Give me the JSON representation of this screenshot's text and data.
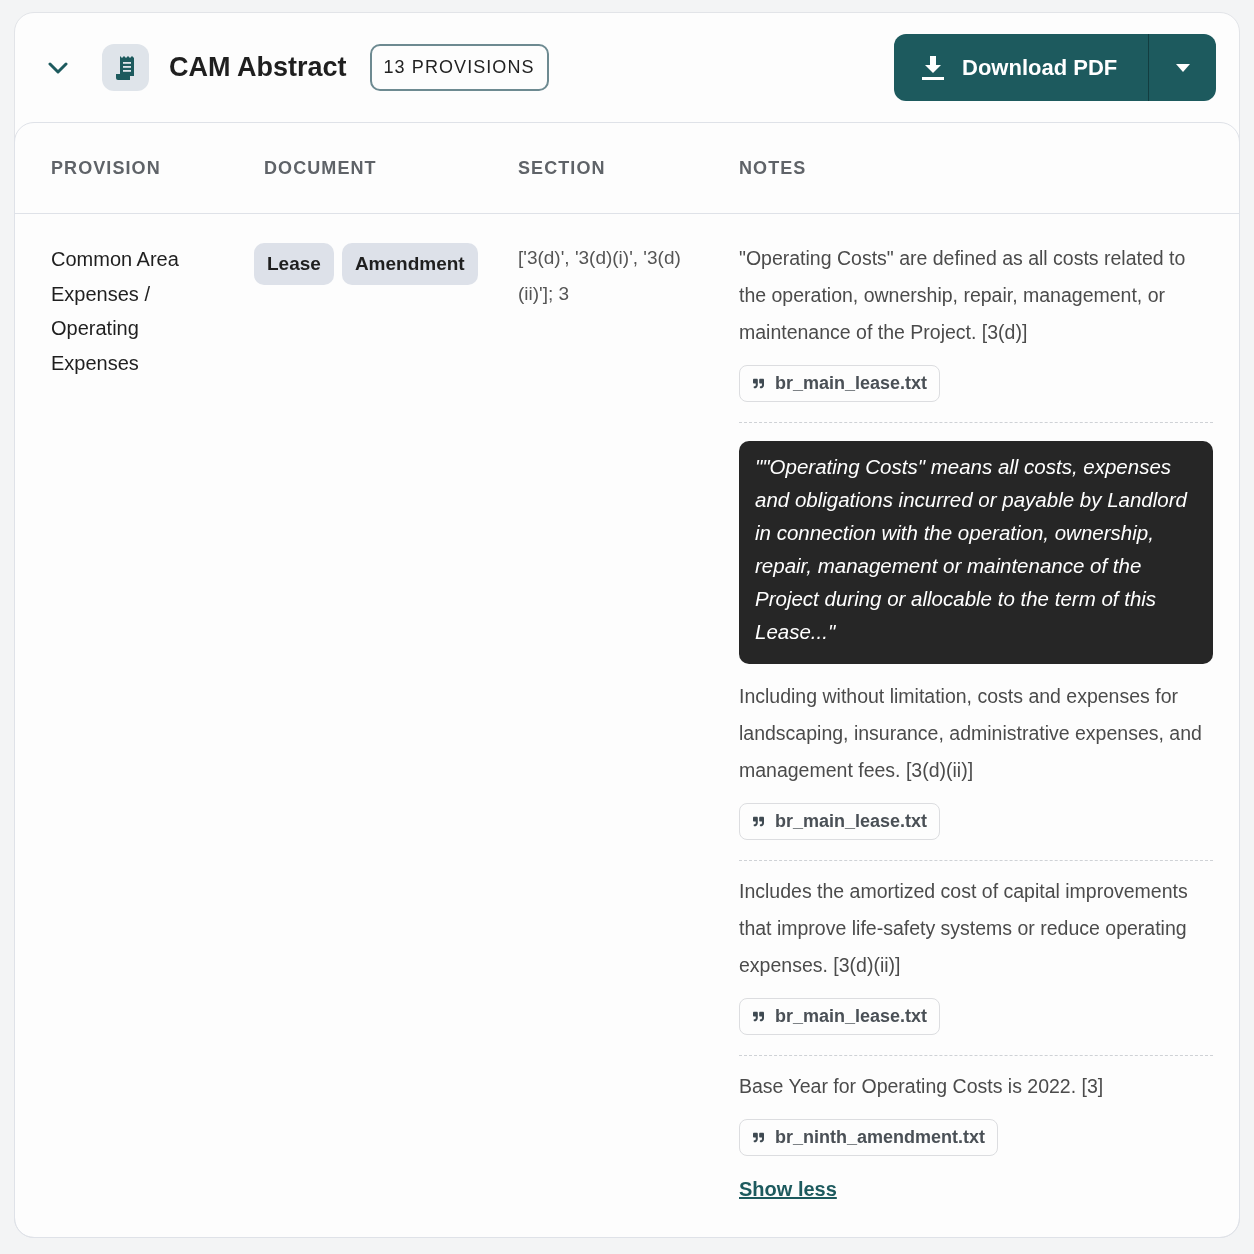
{
  "header": {
    "expanded": true,
    "title": "CAM Abstract",
    "badge": "13 PROVISIONS",
    "download_button": "Download PDF"
  },
  "table": {
    "columns": [
      "PROVISION",
      "DOCUMENT",
      "SECTION",
      "NOTES"
    ],
    "rows": [
      {
        "provision": "Common Area Expenses / Operating Expenses",
        "documents": [
          "Lease",
          "Amendment"
        ],
        "section": "['3(d)', '3(d)(i)', '3(d)(ii)']; 3",
        "notes": [
          {
            "text": "\"Operating Costs\" are defined as all costs related to the operation, ownership, repair, management, or maintenance of the Project. [3(d)]",
            "source": "br_main_lease.txt"
          },
          {
            "quote": "\"\"Operating Costs\" means all costs, expenses and obligations incurred or payable by Landlord in connection with the operation, ownership, repair, management or maintenance of the Project during or allocable to the term of this Lease...\"",
            "text": "Including without limitation, costs and expenses for landscaping, insurance, administrative expenses, and management fees. [3(d)(ii)]",
            "source": "br_main_lease.txt"
          },
          {
            "text": "Includes the amortized cost of capital improvements that improve life-safety systems or reduce operating expenses. [3(d)(ii)]",
            "source": "br_main_lease.txt"
          },
          {
            "text": "Base Year for Operating Costs is 2022. [3]",
            "source": "br_ninth_amendment.txt"
          }
        ],
        "toggle": "Show less"
      }
    ]
  }
}
